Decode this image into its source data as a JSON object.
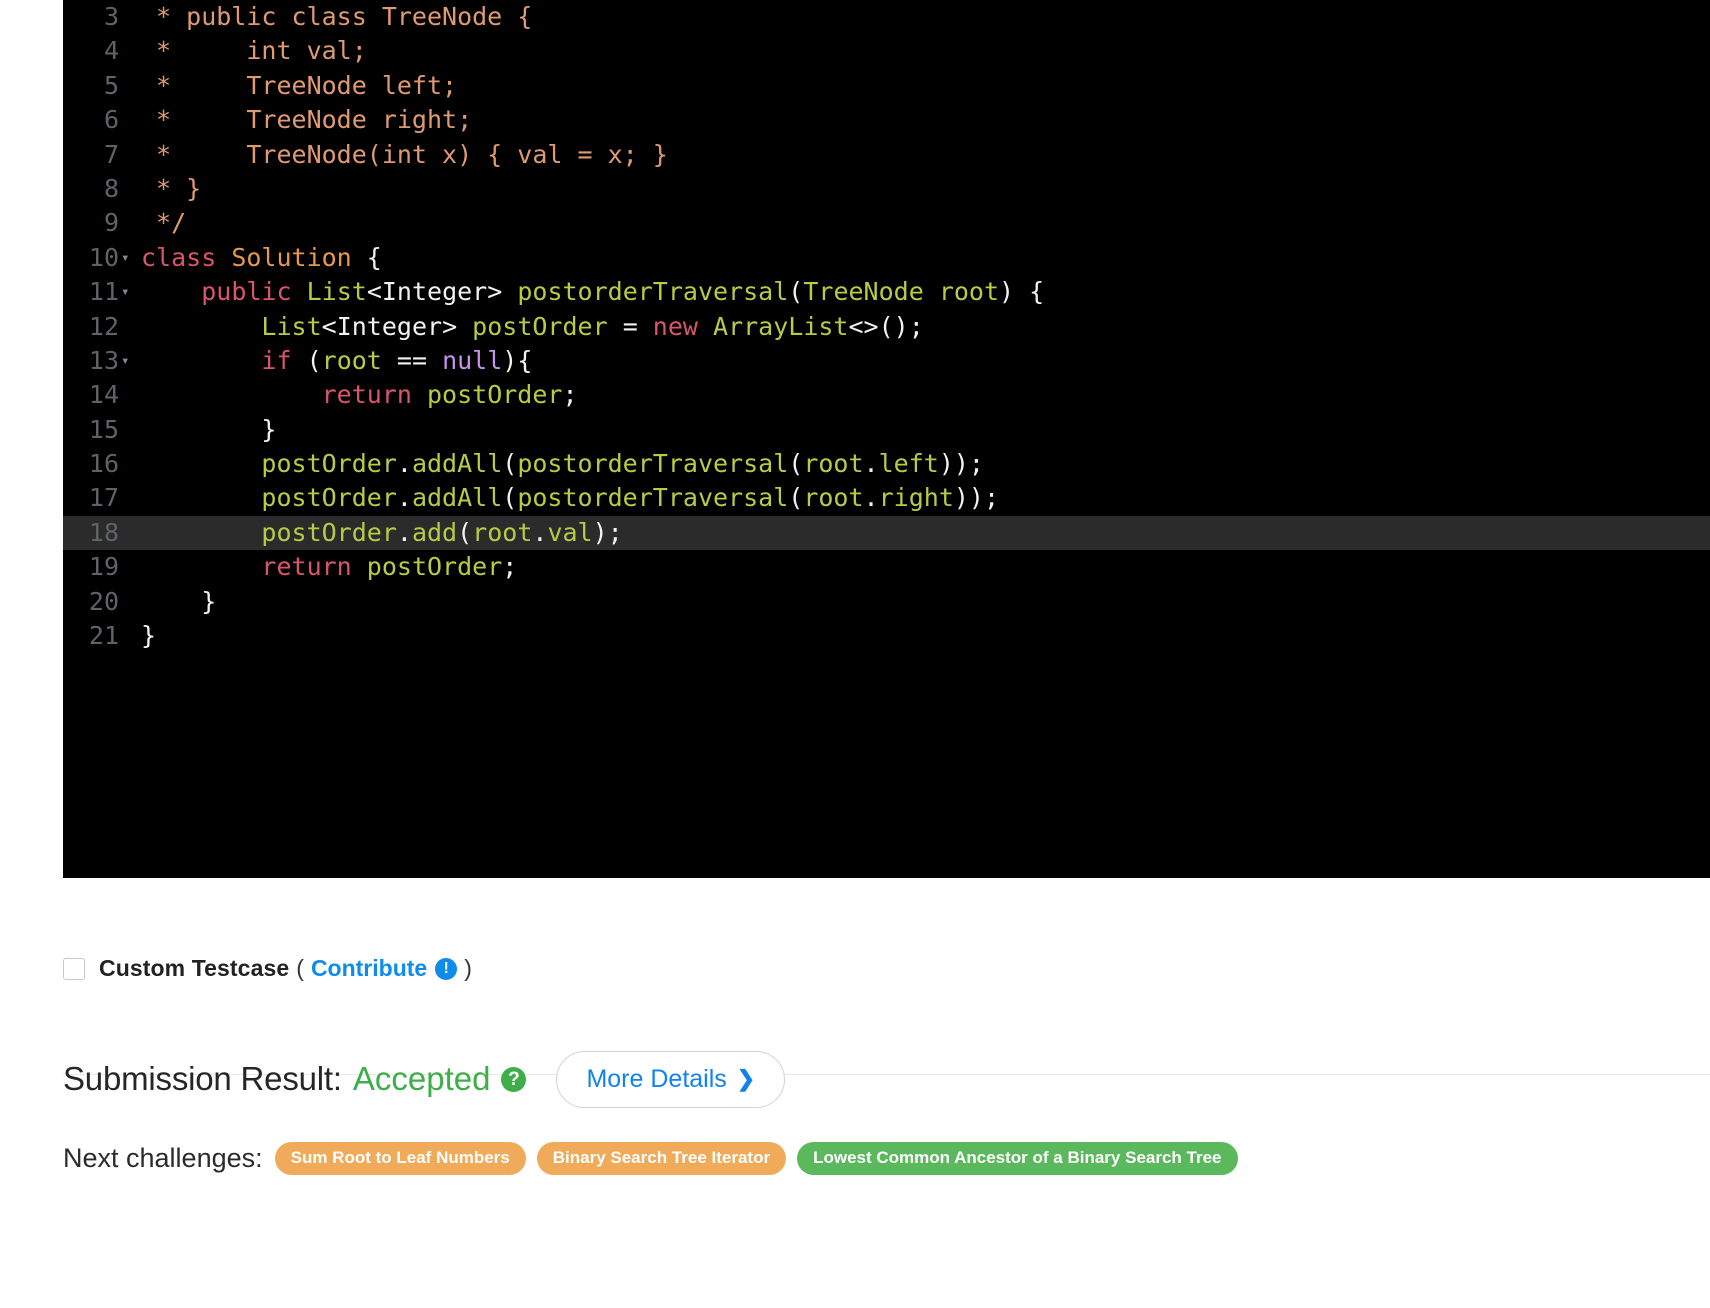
{
  "editor": {
    "language": "java",
    "highlighted_line": 18,
    "background": "#000000",
    "highlight_color": "#2b2b2b",
    "lines": [
      {
        "n": "3",
        "fold": "",
        "tokens": [
          {
            "t": "cm",
            "s": " * public class TreeNode {"
          }
        ]
      },
      {
        "n": "4",
        "fold": "",
        "tokens": [
          {
            "t": "cm",
            "s": " *     int val;"
          }
        ]
      },
      {
        "n": "5",
        "fold": "",
        "tokens": [
          {
            "t": "cm",
            "s": " *     TreeNode left;"
          }
        ]
      },
      {
        "n": "6",
        "fold": "",
        "tokens": [
          {
            "t": "cm",
            "s": " *     TreeNode right;"
          }
        ]
      },
      {
        "n": "7",
        "fold": "",
        "tokens": [
          {
            "t": "cm",
            "s": " *     TreeNode(int x) { val = x; }"
          }
        ]
      },
      {
        "n": "8",
        "fold": "",
        "tokens": [
          {
            "t": "cm",
            "s": " * }"
          }
        ]
      },
      {
        "n": "9",
        "fold": "",
        "tokens": [
          {
            "t": "cm",
            "s": " */"
          }
        ]
      },
      {
        "n": "10",
        "fold": "▾",
        "tokens": [
          {
            "t": "kw",
            "s": "class"
          },
          {
            "t": "pun",
            "s": " "
          },
          {
            "t": "typ",
            "s": "Solution"
          },
          {
            "t": "pun",
            "s": " {"
          }
        ]
      },
      {
        "n": "11",
        "fold": "▾",
        "tokens": [
          {
            "t": "pun",
            "s": "    "
          },
          {
            "t": "kw",
            "s": "public"
          },
          {
            "t": "pun",
            "s": " "
          },
          {
            "t": "id",
            "s": "List"
          },
          {
            "t": "pun",
            "s": "<"
          },
          {
            "t": "pun",
            "s": "Integer"
          },
          {
            "t": "pun",
            "s": "> "
          },
          {
            "t": "id",
            "s": "postorderTraversal"
          },
          {
            "t": "pun",
            "s": "("
          },
          {
            "t": "id",
            "s": "TreeNode"
          },
          {
            "t": "pun",
            "s": " "
          },
          {
            "t": "id",
            "s": "root"
          },
          {
            "t": "pun",
            "s": ") {"
          }
        ]
      },
      {
        "n": "12",
        "fold": "",
        "tokens": [
          {
            "t": "pun",
            "s": "        "
          },
          {
            "t": "id",
            "s": "List"
          },
          {
            "t": "pun",
            "s": "<"
          },
          {
            "t": "pun",
            "s": "Integer"
          },
          {
            "t": "pun",
            "s": "> "
          },
          {
            "t": "id",
            "s": "postOrder"
          },
          {
            "t": "pun",
            "s": " = "
          },
          {
            "t": "kw",
            "s": "new"
          },
          {
            "t": "pun",
            "s": " "
          },
          {
            "t": "id",
            "s": "ArrayList"
          },
          {
            "t": "pun",
            "s": "<>();"
          }
        ]
      },
      {
        "n": "13",
        "fold": "▾",
        "tokens": [
          {
            "t": "pun",
            "s": "        "
          },
          {
            "t": "kw",
            "s": "if"
          },
          {
            "t": "pun",
            "s": " ("
          },
          {
            "t": "id",
            "s": "root"
          },
          {
            "t": "pun",
            "s": " == "
          },
          {
            "t": "lit",
            "s": "null"
          },
          {
            "t": "pun",
            "s": "){"
          }
        ]
      },
      {
        "n": "14",
        "fold": "",
        "tokens": [
          {
            "t": "pun",
            "s": "            "
          },
          {
            "t": "kw",
            "s": "return"
          },
          {
            "t": "pun",
            "s": " "
          },
          {
            "t": "id",
            "s": "postOrder"
          },
          {
            "t": "pun",
            "s": ";"
          }
        ]
      },
      {
        "n": "15",
        "fold": "",
        "tokens": [
          {
            "t": "pun",
            "s": "        }"
          }
        ]
      },
      {
        "n": "16",
        "fold": "",
        "tokens": [
          {
            "t": "pun",
            "s": "        "
          },
          {
            "t": "id",
            "s": "postOrder"
          },
          {
            "t": "pun",
            "s": "."
          },
          {
            "t": "id",
            "s": "addAll"
          },
          {
            "t": "pun",
            "s": "("
          },
          {
            "t": "id",
            "s": "postorderTraversal"
          },
          {
            "t": "pun",
            "s": "("
          },
          {
            "t": "id",
            "s": "root"
          },
          {
            "t": "pun",
            "s": "."
          },
          {
            "t": "id",
            "s": "left"
          },
          {
            "t": "pun",
            "s": "));"
          }
        ]
      },
      {
        "n": "17",
        "fold": "",
        "tokens": [
          {
            "t": "pun",
            "s": "        "
          },
          {
            "t": "id",
            "s": "postOrder"
          },
          {
            "t": "pun",
            "s": "."
          },
          {
            "t": "id",
            "s": "addAll"
          },
          {
            "t": "pun",
            "s": "("
          },
          {
            "t": "id",
            "s": "postorderTraversal"
          },
          {
            "t": "pun",
            "s": "("
          },
          {
            "t": "id",
            "s": "root"
          },
          {
            "t": "pun",
            "s": "."
          },
          {
            "t": "id",
            "s": "right"
          },
          {
            "t": "pun",
            "s": "));"
          }
        ]
      },
      {
        "n": "18",
        "fold": "",
        "hl": true,
        "tokens": [
          {
            "t": "pun",
            "s": "        "
          },
          {
            "t": "id",
            "s": "postOrder"
          },
          {
            "t": "pun",
            "s": "."
          },
          {
            "t": "id",
            "s": "add"
          },
          {
            "t": "pun",
            "s": "("
          },
          {
            "t": "id",
            "s": "root"
          },
          {
            "t": "pun",
            "s": "."
          },
          {
            "t": "id",
            "s": "val"
          },
          {
            "t": "pun",
            "s": ");"
          }
        ]
      },
      {
        "n": "19",
        "fold": "",
        "tokens": [
          {
            "t": "pun",
            "s": "        "
          },
          {
            "t": "kw",
            "s": "return"
          },
          {
            "t": "pun",
            "s": " "
          },
          {
            "t": "id",
            "s": "postOrder"
          },
          {
            "t": "pun",
            "s": ";"
          }
        ]
      },
      {
        "n": "20",
        "fold": "",
        "tokens": [
          {
            "t": "pun",
            "s": "    }"
          }
        ]
      },
      {
        "n": "21",
        "fold": "",
        "tokens": [
          {
            "t": "pun",
            "s": "}"
          }
        ]
      }
    ]
  },
  "testcase": {
    "label": "Custom Testcase",
    "open_paren": "(",
    "close_paren": ")",
    "contribute_label": "Contribute",
    "info_icon": "!",
    "checked": false
  },
  "result": {
    "title": "Submission Result:",
    "status": "Accepted",
    "status_color": "#3fae49",
    "help_icon": "?",
    "more_details_label": "More Details",
    "more_details_chevron": "❯"
  },
  "next_challenges": {
    "label": "Next challenges:",
    "chips": [
      {
        "label": "Sum Root to Leaf Numbers",
        "color": "orange"
      },
      {
        "label": "Binary Search Tree Iterator",
        "color": "orange"
      },
      {
        "label": "Lowest Common Ancestor of a Binary Search Tree",
        "color": "green"
      }
    ]
  }
}
